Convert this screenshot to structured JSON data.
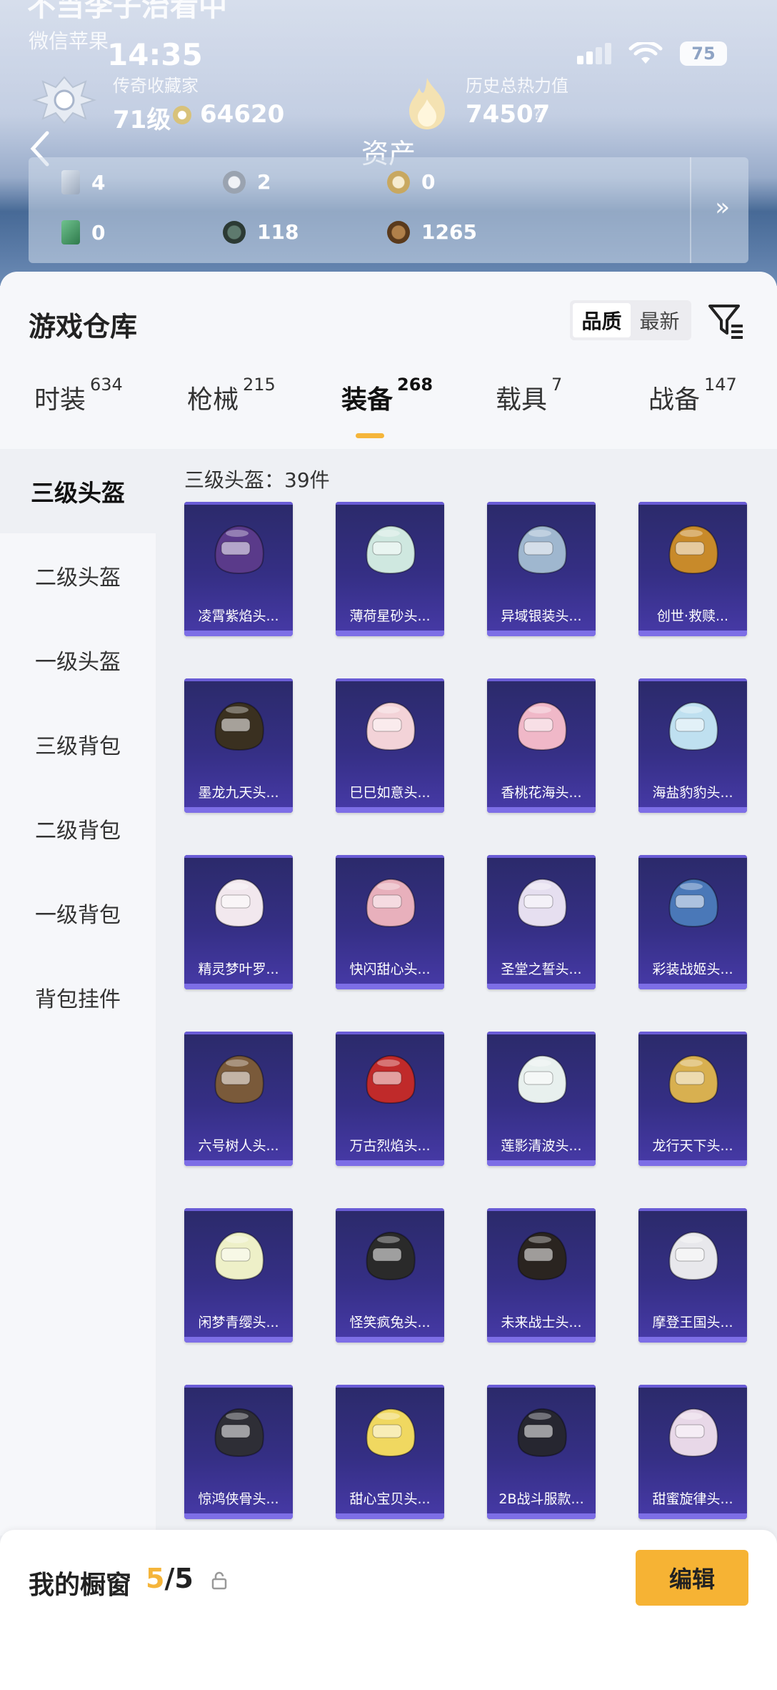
{
  "header": {
    "profile_name": "不当李子治看中",
    "profile_sub": "微信苹果",
    "status": {
      "time": "14:35",
      "battery": "75"
    },
    "rank": {
      "title": "传奇收藏家",
      "level": "71级",
      "coins": "64620"
    },
    "heat": {
      "title": "历史总热力值",
      "value": "74507",
      "help": "?"
    },
    "nav_title": "资产",
    "assets": {
      "row1": [
        "4",
        "2",
        "0"
      ],
      "row2": [
        "0",
        "118",
        "1265"
      ],
      "more": "»"
    }
  },
  "warehouse": {
    "title": "游戏仓库",
    "sort": {
      "quality": "品质",
      "latest": "最新"
    },
    "tabs": [
      {
        "label": "时装",
        "count": "634"
      },
      {
        "label": "枪械",
        "count": "215"
      },
      {
        "label": "装备",
        "count": "268"
      },
      {
        "label": "载具",
        "count": "7"
      },
      {
        "label": "战备",
        "count": "147"
      }
    ],
    "active_tab": "装备",
    "sidebar": [
      "三级头盔",
      "二级头盔",
      "一级头盔",
      "三级背包",
      "二级背包",
      "一级背包",
      "背包挂件"
    ],
    "active_category": "三级头盔",
    "count_label": "三级头盔：39件",
    "items": [
      {
        "name": "凌霄紫焰头...",
        "color": "#5a3a8a"
      },
      {
        "name": "薄荷星砂头...",
        "color": "#cfe8e0"
      },
      {
        "name": "异域银装头...",
        "color": "#9fb7cf"
      },
      {
        "name": "创世·救赎...",
        "color": "#c88a2a"
      },
      {
        "name": "墨龙九天头...",
        "color": "#3a3020"
      },
      {
        "name": "巳巳如意头...",
        "color": "#f3d3d8"
      },
      {
        "name": "香桃花海头...",
        "color": "#f0b8c8"
      },
      {
        "name": "海盐豹豹头...",
        "color": "#bfe0f0"
      },
      {
        "name": "精灵梦叶罗...",
        "color": "#f2e8ee"
      },
      {
        "name": "快闪甜心头...",
        "color": "#e8b0bc"
      },
      {
        "name": "圣堂之誓头...",
        "color": "#e6dff0"
      },
      {
        "name": "彩装战姬头...",
        "color": "#4a78b8"
      },
      {
        "name": "六号树人头...",
        "color": "#7a5a3a"
      },
      {
        "name": "万古烈焰头...",
        "color": "#c02a2a"
      },
      {
        "name": "莲影清波头...",
        "color": "#e8f0ee"
      },
      {
        "name": "龙行天下头...",
        "color": "#d8b050"
      },
      {
        "name": "闲梦青缨头...",
        "color": "#eef0c8"
      },
      {
        "name": "怪笑疯兔头...",
        "color": "#2a2a2a"
      },
      {
        "name": "未来战士头...",
        "color": "#2a2420"
      },
      {
        "name": "摩登王国头...",
        "color": "#e8e8ec"
      },
      {
        "name": "惊鸿侠骨头...",
        "color": "#2e2e36"
      },
      {
        "name": "甜心宝贝头...",
        "color": "#f0d860"
      },
      {
        "name": "2B战斗服款...",
        "color": "#262630"
      },
      {
        "name": "甜蜜旋律头...",
        "color": "#e8d8e8"
      }
    ]
  },
  "showcase": {
    "title": "我的橱窗",
    "current": "5",
    "separator": "/",
    "total": "5",
    "edit_label": "编辑"
  },
  "colors": {
    "accent": "#f5b53a",
    "card_bg": "#352f85",
    "edit_button": "#f6b334"
  }
}
